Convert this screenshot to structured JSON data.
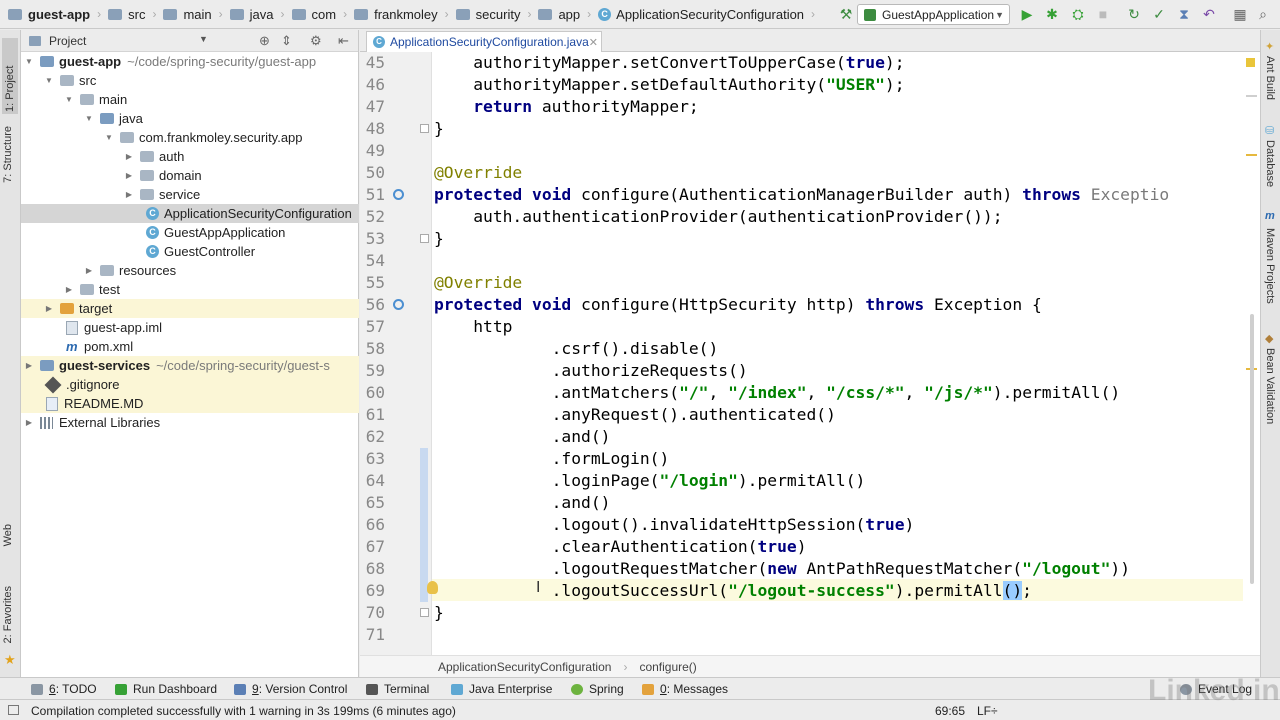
{
  "navbar": {
    "crumbs": [
      "guest-app",
      "src",
      "main",
      "java",
      "com",
      "frankmoley",
      "security",
      "app",
      "ApplicationSecurityConfiguration"
    ],
    "run_config": "GuestAppApplication"
  },
  "left_strip": {
    "tabs": [
      "1: Project",
      "7: Structure",
      "Web",
      "2: Favorites"
    ]
  },
  "project": {
    "title": "Project",
    "tree": [
      {
        "label": "guest-app",
        "hint": "~/code/spring-security/guest-app"
      },
      {
        "label": "src"
      },
      {
        "label": "main"
      },
      {
        "label": "java"
      },
      {
        "label": "com.frankmoley.security.app"
      },
      {
        "label": "auth"
      },
      {
        "label": "domain"
      },
      {
        "label": "service"
      },
      {
        "label": "ApplicationSecurityConfiguration"
      },
      {
        "label": "GuestAppApplication"
      },
      {
        "label": "GuestController"
      },
      {
        "label": "resources"
      },
      {
        "label": "test"
      },
      {
        "label": "target"
      },
      {
        "label": "guest-app.iml"
      },
      {
        "label": "pom.xml"
      },
      {
        "label": "guest-services",
        "hint": "~/code/spring-security/guest-s"
      },
      {
        "label": ".gitignore"
      },
      {
        "label": "README.MD"
      },
      {
        "label": "External Libraries"
      }
    ]
  },
  "editor": {
    "tab_label": "ApplicationSecurityConfiguration.java",
    "line_numbers": [
      "45",
      "46",
      "47",
      "48",
      "49",
      "50",
      "51",
      "52",
      "53",
      "54",
      "55",
      "56",
      "57",
      "58",
      "59",
      "60",
      "61",
      "62",
      "63",
      "64",
      "65",
      "66",
      "67",
      "68",
      "69",
      "70",
      "71"
    ],
    "code": {
      "l45": {
        "a": "    authorityMapper.setConvertToUpperCase(",
        "b": "true",
        "c": ");"
      },
      "l46": {
        "a": "    authorityMapper.setDefaultAuthority(",
        "b": "\"USER\"",
        "c": ");"
      },
      "l47": {
        "a": "return",
        "b": " authorityMapper;"
      },
      "l48": "}",
      "l50": "@Override",
      "l51": {
        "a": "protected void",
        "b": " configure(AuthenticationManagerBuilder auth) ",
        "c": "throws",
        "d": " Exceptio"
      },
      "l52": "    auth.authenticationProvider(authenticationProvider());",
      "l53": "}",
      "l55": "@Override",
      "l56": {
        "a": "protected void",
        "b": " configure(HttpSecurity http) ",
        "c": "throws",
        "d": " Exception {"
      },
      "l57": "    http",
      "l58": "            .csrf().disable()",
      "l59": "            .authorizeRequests()",
      "l60": {
        "a": "            .antMatchers(",
        "b": "\"/\"",
        "c": ", ",
        "d": "\"/index\"",
        "e": ", ",
        "f": "\"/css/*\"",
        "g": ", ",
        "h": "\"/js/*\"",
        "i": ").permitAll()"
      },
      "l61": "            .anyRequest().authenticated()",
      "l62": "            .and()",
      "l63": "            .formLogin()",
      "l64": {
        "a": "            .loginPage(",
        "b": "\"/login\"",
        "c": ").permitAll()"
      },
      "l65": "            .and()",
      "l66": {
        "a": "            .logout().invalidateHttpSession(",
        "b": "true",
        "c": ")"
      },
      "l67": {
        "a": "            .clearAuthentication(",
        "b": "true",
        "c": ")"
      },
      "l68": {
        "a": "            .logoutRequestMatcher(",
        "b": "new",
        "c": " AntPathRequestMatcher(",
        "d": "\"/logout\"",
        "e": "))"
      },
      "l69": {
        "a": "            .logoutSuccessUrl(",
        "b": "\"/logout-success\"",
        "c": ").permitAll",
        "d": "()",
        "e": ";"
      },
      "l70": "}"
    },
    "breadcrumb": [
      "ApplicationSecurityConfiguration",
      "configure()"
    ]
  },
  "right_strip": {
    "tabs": [
      "Ant Build",
      "Database",
      "Maven Projects",
      "Bean Validation"
    ]
  },
  "tool_windows": [
    {
      "key": "6",
      "label": ": TODO"
    },
    {
      "label": "Run Dashboard"
    },
    {
      "key": "9",
      "label": ": Version Control"
    },
    {
      "label": "Terminal"
    },
    {
      "label": "Java Enterprise"
    },
    {
      "label": "Spring"
    },
    {
      "key": "0",
      "label": ": Messages"
    },
    {
      "label": "Event Log"
    }
  ],
  "status": {
    "message": "Compilation completed successfully with 1 warning in 3s 199ms (6 minutes ago)",
    "position": "69:65",
    "line_sep": "LF÷"
  },
  "watermark": "Linked in",
  "colors": {
    "keyword": "#000080",
    "string": "#008000",
    "annotation": "#808000",
    "current_line": "#fcfade"
  }
}
